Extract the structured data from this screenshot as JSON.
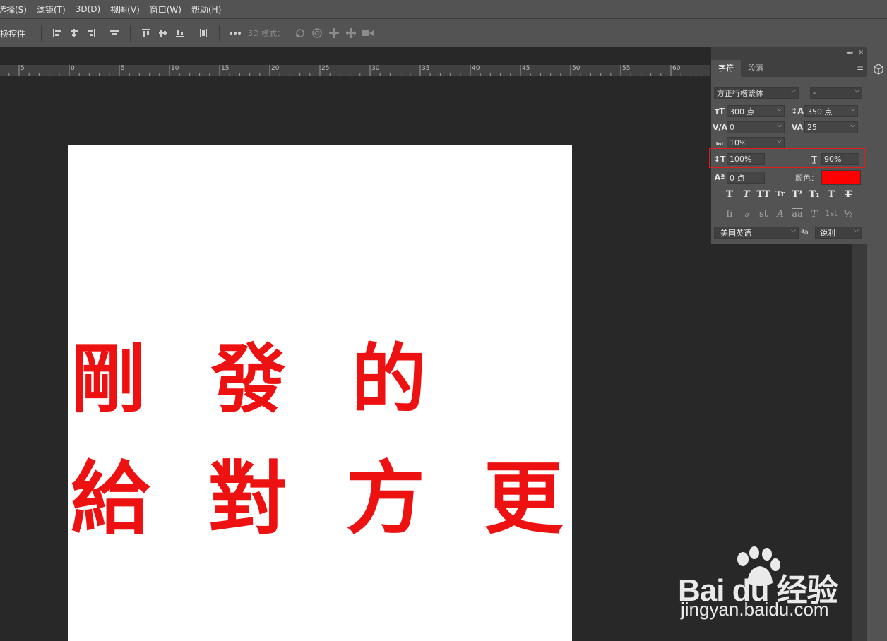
{
  "menu": [
    "选择(S)",
    "滤镜(T)",
    "3D(D)",
    "视图(V)",
    "窗口(W)",
    "帮助(H)"
  ],
  "options": {
    "transform_label": "换控件",
    "mode3d_label": "3D 模式："
  },
  "ruler": {
    "labels": [
      "5",
      "0",
      "5",
      "10",
      "15",
      "20",
      "25",
      "30",
      "35",
      "40",
      "45",
      "50",
      "55",
      "60"
    ]
  },
  "canvas": {
    "line1": "剛 發 的",
    "line2": "給 對 方 更 多"
  },
  "panel": {
    "tabs": [
      "字符",
      "段落"
    ],
    "font_family": "方正行楷繁体",
    "font_style": "-",
    "font_size": "300 点",
    "leading": "350 点",
    "kerning": "0",
    "tracking": "25",
    "scale_percent": "10%",
    "vertical_scale": "100%",
    "horizontal_scale": "90%",
    "baseline_shift": "0 点",
    "color_label": "颜色：",
    "color_value": "#ff0000",
    "style_buttons": [
      "T",
      "T",
      "TT",
      "Tr",
      "T¹",
      "T₁",
      "T",
      "T"
    ],
    "opentype_buttons": [
      "fi",
      "ℴ",
      "st",
      "A",
      "aa",
      "T",
      "1st",
      "½"
    ],
    "language": "美国英语",
    "aa_label": "ªa",
    "antialias": "锐利"
  },
  "watermark": {
    "brand": "Bai du 经验",
    "url": "jingyan.baidu.com"
  }
}
